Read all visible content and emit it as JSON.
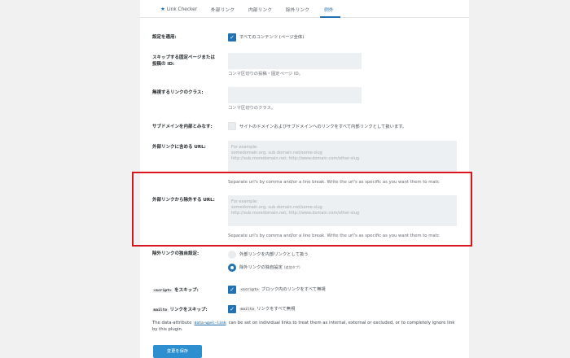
{
  "tabs": [
    {
      "label": "Link Checker",
      "icon": "star-icon"
    },
    {
      "label": "外部リンク"
    },
    {
      "label": "内部リンク"
    },
    {
      "label": "除外リンク"
    },
    {
      "label": "例外",
      "active": true
    }
  ],
  "settings": {
    "apply": {
      "label": "設定を適用:",
      "checkbox_label": "すべてのコンテンツ (ページ全体)",
      "checked": true
    },
    "skip_pages": {
      "label": "スキップする固定ページまたは投稿の ID:",
      "value": "",
      "help": "コンマ区切りの投稿・固定ページ ID。"
    },
    "ignore_classes": {
      "label": "無視するリンクのクラス:",
      "value": "",
      "help": "コンマ区切りのクラス。"
    },
    "subdomains": {
      "label": "サブドメインを内部とみなす:",
      "checkbox_label": "サイトのドメインおよびサブドメインへのリンクをすべて内部リンクとして扱います。",
      "checked": false
    },
    "include_urls": {
      "label": "外部リンクに含める URL:",
      "placeholder": "For example:\nsomedomain.org, sub.domain.net/some-slug\nhttp://sub.moredomain.net, http://www.domain.com/other-slug",
      "help": "Separate url's by comma and/or a line break. Write the url's as specific as you want them to matc"
    },
    "exclude_urls": {
      "label": "外部リンクから除外する URL:",
      "placeholder": "For example:\nsomedomain.org, sub.domain.net/some-slug\nhttp://sub.moredomain.net, http://www.domain.com/other-slug",
      "help": "Separate url's by comma and/or a line break. Write the url's as specific as you want them to matc"
    },
    "excluded_settings": {
      "label": "除外リンクの独自設定:",
      "options": [
        {
          "label": "外部リンクを内部リンクとして扱う",
          "selected": false
        },
        {
          "label": "除外リンクの独自設定",
          "note": "(追加タブ)",
          "selected": true
        }
      ]
    },
    "skip_script": {
      "label_code": "<script>",
      "label_text": "をスキップ:",
      "checkbox_code": "<script>",
      "checkbox_text": "ブロック内のリンクをすべて無視",
      "checked": true
    },
    "skip_mailto": {
      "label_code": "mailto",
      "label_text": "リンクをスキップ:",
      "checkbox_code": "mailto",
      "checkbox_text": "リンクをすべて無視",
      "checked": true
    }
  },
  "data_attr_note": {
    "before": "The data-attribute",
    "code": "data-wpel-link",
    "after": "can be set on individual links to treat them as internal, external or excluded, or to completely ignore link by this plugin."
  },
  "save_button": "変更を保存",
  "colors": {
    "accent": "#2271b1",
    "highlight": "#d9141c",
    "save": "#2d8fcf"
  }
}
